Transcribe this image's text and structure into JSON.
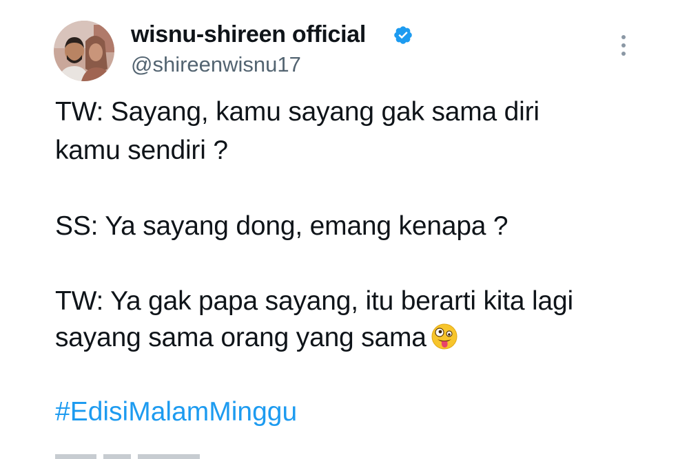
{
  "author": {
    "display_name": "wisnu-shireen official",
    "handle": "@shireenwisnu17",
    "verified": true
  },
  "tweet": {
    "lines": [
      "TW: Sayang, kamu sayang gak sama diri",
      "kamu sendiri ?",
      "SS: Ya sayang dong, emang kenapa ?",
      "TW: Ya gak papa sayang, itu berarti kita lagi",
      "sayang sama orang yang sama"
    ],
    "emoji": "zany-face-emoji",
    "hashtag": "#EdisiMalamMinggu"
  },
  "icons": {
    "verified": "verified-badge-icon",
    "more": "more-vertical-icon"
  },
  "colors": {
    "text": "#0f1419",
    "secondary_text": "#536471",
    "link": "#1d9bf0",
    "verified_badge": "#1d9bf0"
  }
}
